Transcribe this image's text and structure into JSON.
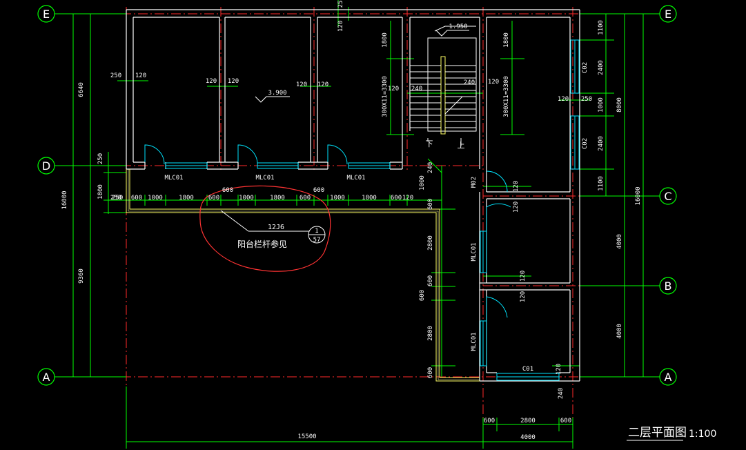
{
  "drawing": {
    "title": "二层平面图",
    "scale": "1:100",
    "note": "阳台栏杆参见",
    "detail_ref": "12J6",
    "detail_num": "1",
    "detail_sheet": "57",
    "elev_room": "3.900",
    "elev_stair": "1.950",
    "stair_down": "下",
    "stair_up": "上"
  },
  "axes": {
    "E": "E",
    "D": "D",
    "C": "C",
    "B": "B",
    "A": "A"
  },
  "doors_windows": {
    "mlc01_a": "MLC01",
    "mlc01_b": "MLC01",
    "mlc01_c": "MLC01",
    "mlc01_d": "MLC01",
    "mlc01_e": "MLC01",
    "m02": "M02",
    "c01": "C01",
    "c02_a": "C02",
    "c02_b": "C02"
  },
  "dims": {
    "left_6640": "6640",
    "left_16000": "16000",
    "left_9360": "9360",
    "left_250a": "250",
    "left_1800": "1800",
    "left_250b": "250",
    "right_1100a": "1100",
    "right_2400a": "2400",
    "right_1000": "1000",
    "right_2400b": "2400",
    "right_1100b": "1100",
    "right_8000": "8000",
    "right_4000a": "4000",
    "right_4000b": "4000",
    "right_16000": "16000",
    "bot_15500": "15500",
    "bot_4000": "4000",
    "bot_600a": "600",
    "bot_2800": "2800",
    "bot_600b": "600",
    "r_250": "250",
    "r_120a": "120",
    "r_120b": "120",
    "r_120c": "120",
    "r_120d": "120",
    "r_120e": "120",
    "r_120f": "120",
    "r_120g": "120",
    "r_120h": "120",
    "r_120i": "120",
    "r_120j": "120",
    "top_25": "25",
    "stair_1800a": "1800",
    "stair_1800b": "1800",
    "stair_run_a": "300X11=3300",
    "stair_run_b": "300X11=3300",
    "stair_240a": "240",
    "stair_240b": "240",
    "stair_120": "120",
    "bal_250": "250",
    "bal_600a": "600",
    "bal_1000a": "1000",
    "bal_1800a": "1800",
    "bal_600b": "600",
    "bal_1000b": "1000",
    "bal_1800b": "1800",
    "bal_600c": "600",
    "bal_1000c": "1000",
    "bal_1800c": "1800",
    "bal_600d": "600",
    "bal_120": "120",
    "bal_600top_a": "600",
    "bal_600top_b": "600",
    "v_240": "240",
    "v_1000": "1000",
    "v_600a": "600",
    "v_2800a": "2800",
    "v_600b": "600",
    "v_600c": "600",
    "v_2800b": "2800",
    "v_600d": "600",
    "v_240b": "240"
  },
  "colors": {
    "background": "#000000",
    "wall": "#ffffff",
    "axis": "#ff2a2a",
    "dimension": "#00ff00",
    "window": "#00e5ff",
    "railing": "#ffff66",
    "annotation": "#ff3333"
  }
}
